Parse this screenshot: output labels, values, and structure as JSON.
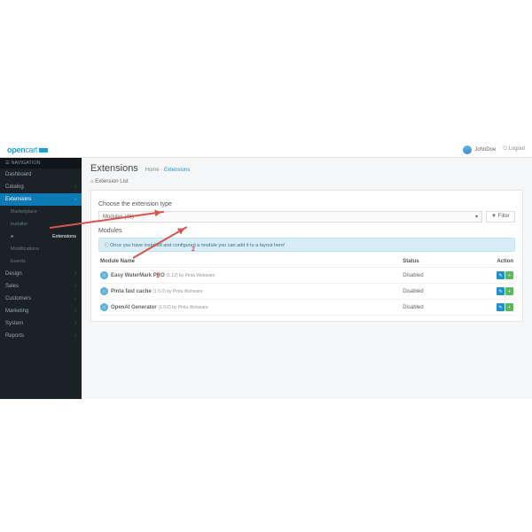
{
  "header": {
    "brand_a": "open",
    "brand_b": "cart",
    "user": "JohnDoe",
    "logout": "⎋ Logout"
  },
  "nav": {
    "title": "☰ NAVIGATION",
    "items": [
      "Dashboard",
      "Catalog",
      "Extensions",
      "Design",
      "Sales",
      "Customers",
      "Marketing",
      "System",
      "Reports"
    ],
    "subs": [
      "Marketplace",
      "Installer",
      "Extensions",
      "Modifications",
      "Events"
    ]
  },
  "page": {
    "title": "Extensions",
    "bc_home": "Home",
    "bc_ext": "Extensions",
    "list_head": "⌂ Extension List",
    "choose": "Choose the extension type",
    "sel": "Modules (46)",
    "filter": "▼ Filter",
    "section": "Modules",
    "info": "ⓘ Once you have installed and configured a module you can add it to a layout here!",
    "col_name": "Module Name",
    "col_status": "Status",
    "col_action": "Action"
  },
  "rows": [
    {
      "name": "Easy WaterMark PRO",
      "ver": "(1.12) by Pinta Webware",
      "status": "Disabled"
    },
    {
      "name": "Pinta fast cache",
      "ver": "(1.5.0) by Pinta Webware",
      "status": "Disabled"
    },
    {
      "name": "OpenAI Generator",
      "ver": "(1.0.0) by Pinta Webware",
      "status": "Disabled"
    }
  ],
  "ann": {
    "n1": "1",
    "n2": "2"
  }
}
